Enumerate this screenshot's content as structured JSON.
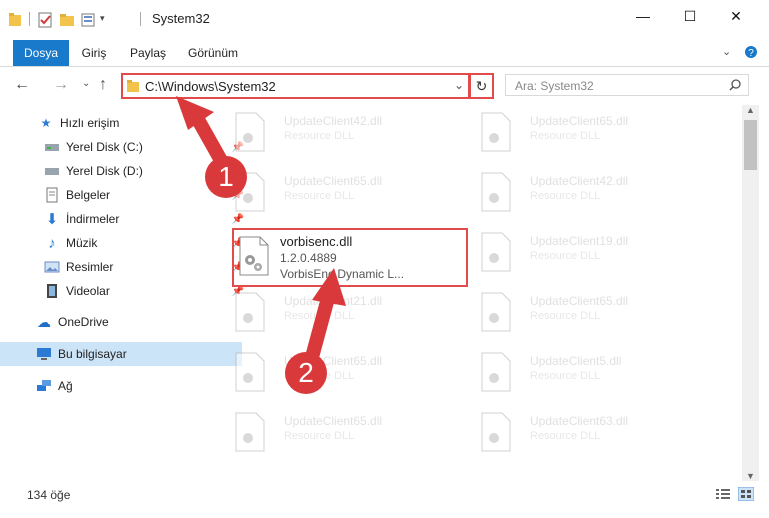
{
  "window": {
    "title": "System32",
    "minimize_label": "—",
    "maximize_label": "☐",
    "close_label": "✕"
  },
  "ribbon": {
    "tabs": [
      {
        "label": "Dosya",
        "active": true
      },
      {
        "label": "Giriş"
      },
      {
        "label": "Paylaş"
      },
      {
        "label": "Görünüm"
      }
    ],
    "expand_icon": "chevron-down-icon",
    "help_icon": "help-icon"
  },
  "address": {
    "path": "C:\\Windows\\System32",
    "refresh_icon": "refresh-icon",
    "search_placeholder": "Ara: System32"
  },
  "nav": {
    "items": [
      {
        "label": "Hızlı erişim",
        "icon": "star-icon"
      },
      {
        "label": "Yerel Disk (C:)",
        "icon": "drive-icon",
        "pinned": true
      },
      {
        "label": "Yerel Disk (D:)",
        "icon": "drive-icon",
        "pinned": true
      },
      {
        "label": "Belgeler",
        "icon": "document-icon",
        "pinned": true
      },
      {
        "label": "İndirmeler",
        "icon": "download-icon",
        "pinned": true
      },
      {
        "label": "Müzik",
        "icon": "music-icon",
        "pinned": true
      },
      {
        "label": "Resimler",
        "icon": "pictures-icon",
        "pinned": true
      },
      {
        "label": "Videolar",
        "icon": "video-icon",
        "pinned": true
      },
      {
        "label": "OneDrive",
        "icon": "cloud-icon"
      },
      {
        "label": "Bu bilgisayar",
        "icon": "computer-icon",
        "selected": true
      },
      {
        "label": "Ağ",
        "icon": "network-icon"
      }
    ]
  },
  "files": {
    "left": [
      {
        "name": "UpdateClient42.dll",
        "desc": "Resource DLL"
      },
      {
        "name": "UpdateClient65.dll",
        "desc": "Resource DLL"
      },
      {
        "name": "UpdateClient21.dll",
        "desc": "Resource DLL"
      },
      {
        "name": "UpdateClient65.dll",
        "desc": "Resource DLL"
      },
      {
        "name": "UpdateClient65.dll",
        "desc": "Resource DLL"
      }
    ],
    "right": [
      {
        "name": "UpdateClient65.dll",
        "desc": "Resource DLL"
      },
      {
        "name": "UpdateClient42.dll",
        "desc": "Resource DLL"
      },
      {
        "name": "UpdateClient19.dll",
        "desc": "Resource DLL"
      },
      {
        "name": "UpdateClient65.dll",
        "desc": "Resource DLL"
      },
      {
        "name": "UpdateClient5.dll",
        "desc": "Resource DLL"
      },
      {
        "name": "UpdateClient63.dll",
        "desc": "Resource DLL"
      }
    ],
    "highlighted": {
      "name": "vorbisenc.dll",
      "version": "1.2.0.4889",
      "desc": "VorbisEnc Dynamic L..."
    }
  },
  "status": {
    "count": "134 öğe"
  },
  "annotations": {
    "step1": "1",
    "step2": "2",
    "color": "#d9393a"
  }
}
